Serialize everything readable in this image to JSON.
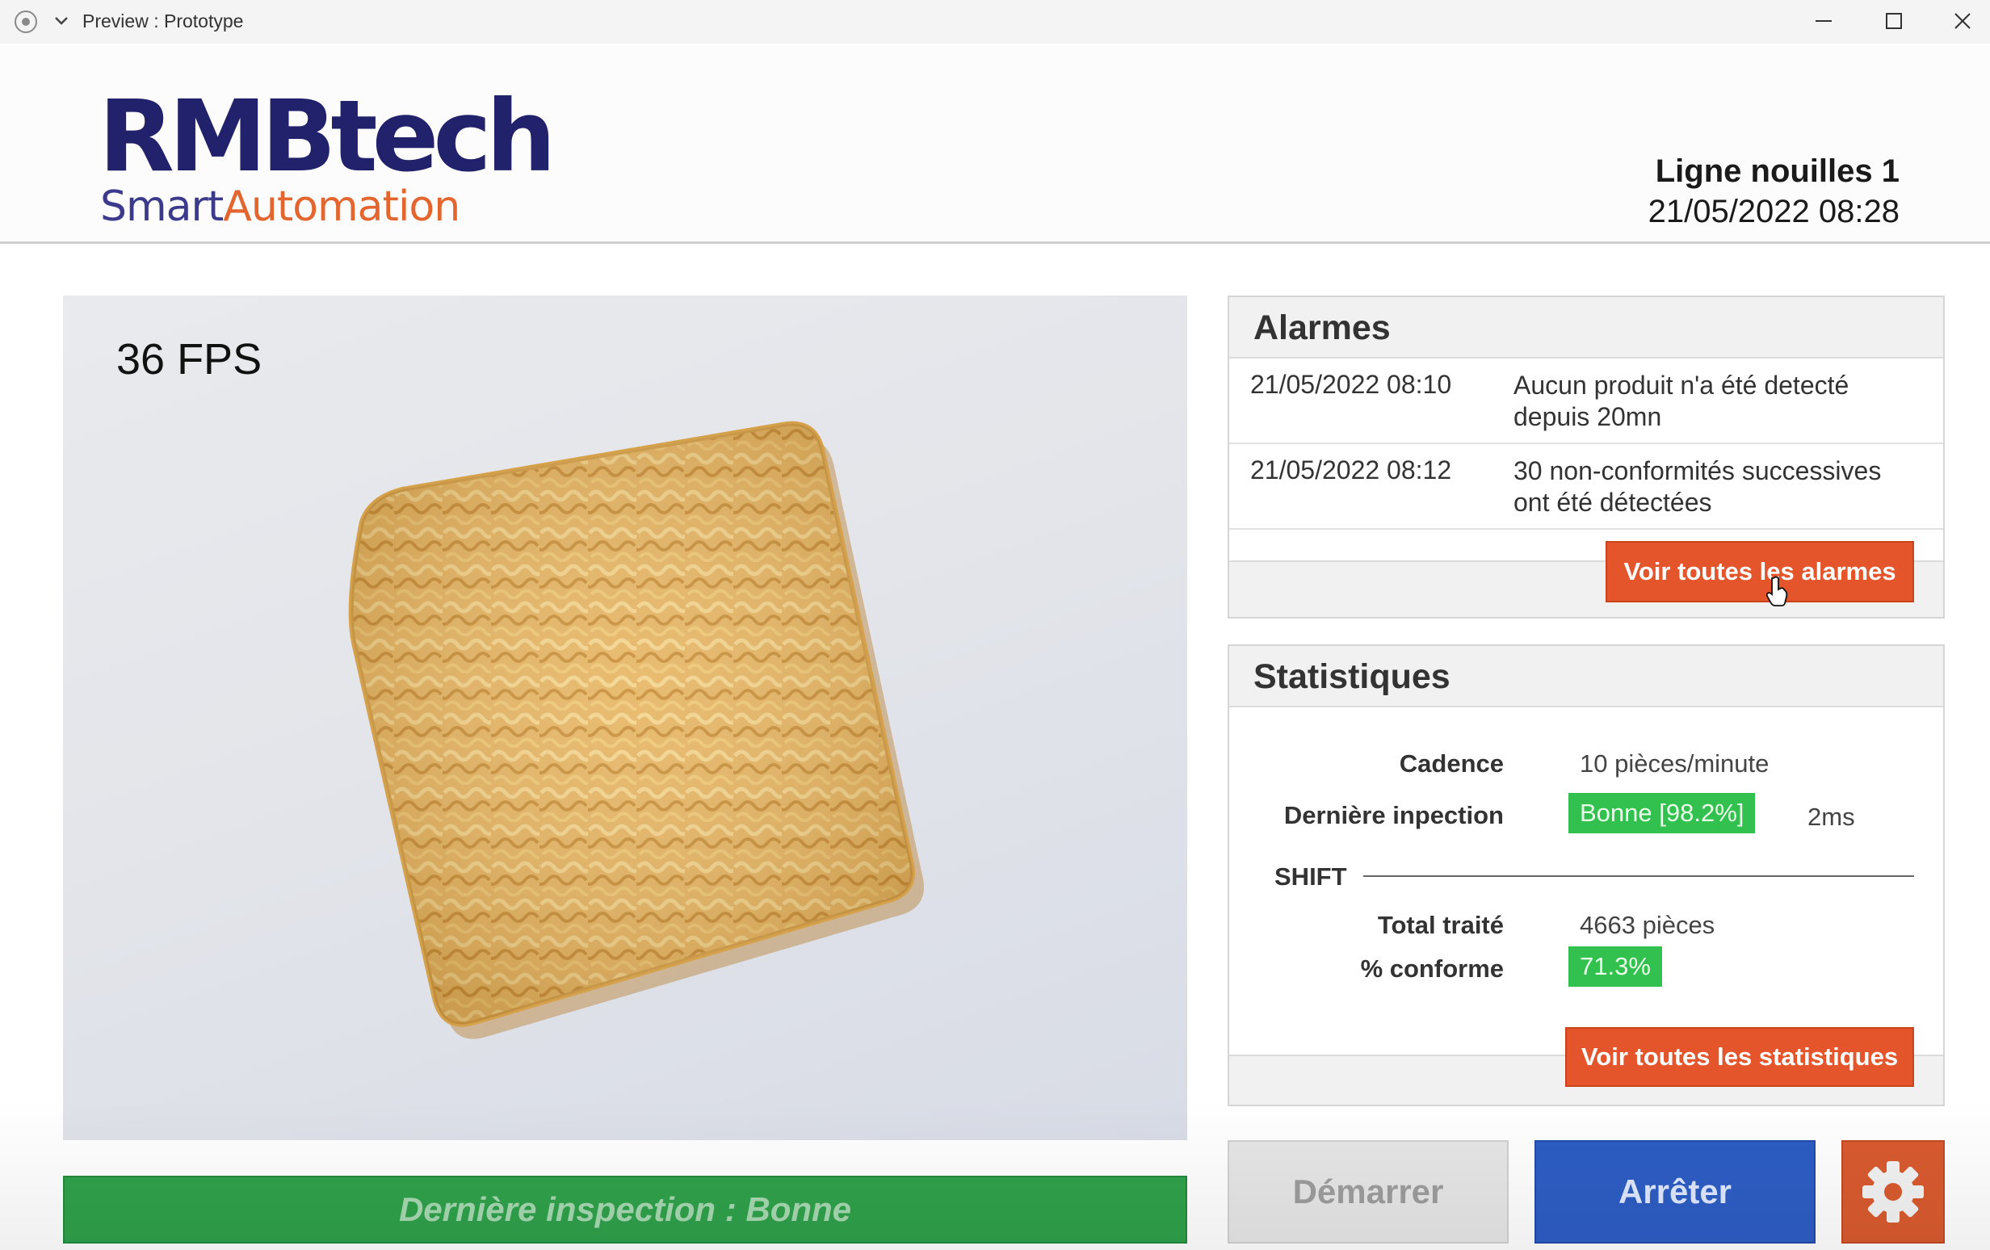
{
  "window": {
    "title": "Preview : Prototype",
    "controls": [
      "minimize-icon",
      "maximize-icon",
      "close-icon"
    ]
  },
  "header": {
    "logo_main": "RMBtech",
    "logo_smart": "Smart",
    "logo_automation": "Automation",
    "line_name": "Ligne nouilles 1",
    "datetime": "21/05/2022 08:28"
  },
  "camera": {
    "fps": "36 FPS",
    "status_text": "Dernière inspection :  Bonne",
    "status_color": "#2fa14b"
  },
  "alarms": {
    "title": "Alarmes",
    "items": [
      {
        "time": "21/05/2022 08:10",
        "message": "Aucun produit n'a été detecté depuis 20mn"
      },
      {
        "time": "21/05/2022 08:12",
        "message": "30 non-conformités successives ont été détectées"
      }
    ],
    "button": "Voir toutes les alarmes"
  },
  "stats": {
    "title": "Statistiques",
    "cadence_label": "Cadence",
    "cadence_value": "10 pièces/minute",
    "last_label": "Dernière inpection",
    "last_badge": "Bonne [98.2%]",
    "last_time": "2ms",
    "shift_label": "SHIFT",
    "total_label": "Total traité",
    "total_value": "4663 pièces",
    "conform_label": "% conforme",
    "conform_value": "71.3%",
    "button": "Voir toutes les statistiques"
  },
  "controls": {
    "start": "Démarrer",
    "stop": "Arrêter",
    "settings_icon": "gear-icon"
  },
  "colors": {
    "brand_navy": "#22216b",
    "brand_orange": "#e4662f",
    "accent_button": "#e4552b",
    "ok_green": "#32c14f",
    "stop_blue": "#2d5dc4"
  }
}
